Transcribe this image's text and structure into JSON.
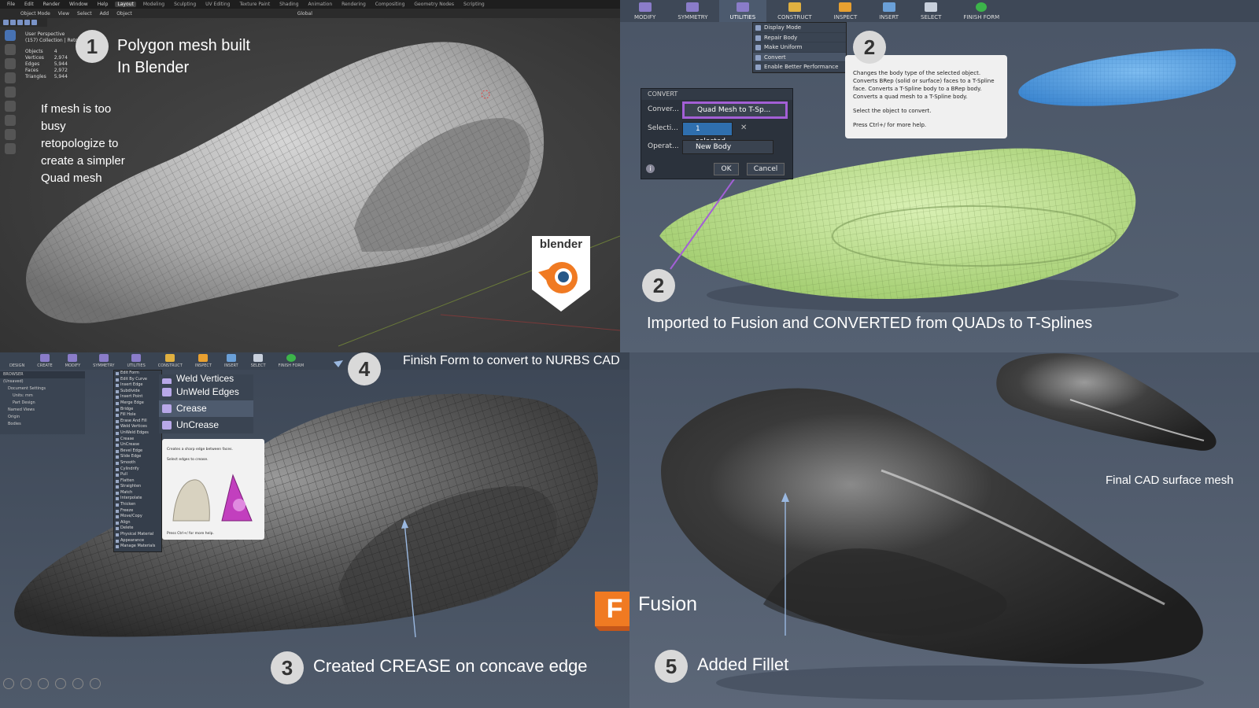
{
  "blender": {
    "menubar": [
      "File",
      "Edit",
      "Render",
      "Window",
      "Help"
    ],
    "workspaces": [
      "Layout",
      "Modeling",
      "Sculpting",
      "UV Editing",
      "Texture Paint",
      "Shading",
      "Animation",
      "Rendering",
      "Compositing",
      "Geometry Nodes",
      "Scripting"
    ],
    "header_items": [
      "Object Mode",
      "View",
      "Select",
      "Add",
      "Object"
    ],
    "orientation": "Global",
    "viewport_title": "User Perspective",
    "collection": "(157) Collection | Retopo",
    "stats": [
      {
        "label": "Objects",
        "value": "4"
      },
      {
        "label": "Vertices",
        "value": "2,974"
      },
      {
        "label": "Edges",
        "value": "5,944"
      },
      {
        "label": "Faces",
        "value": "2,972"
      },
      {
        "label": "Triangles",
        "value": "5,944"
      }
    ],
    "step_number": "1",
    "caption_line1": "Polygon mesh built",
    "caption_line2": "In Blender",
    "note_lines": [
      "If mesh is too",
      "busy",
      "retopologize to",
      "create a simpler",
      "Quad mesh"
    ],
    "logo_text": "blender"
  },
  "fusion_convert": {
    "toolbar": [
      "MODIFY",
      "SYMMETRY",
      "UTILITIES",
      "CONSTRUCT",
      "INSPECT",
      "INSERT",
      "SELECT",
      "FINISH FORM"
    ],
    "utilities_menu": [
      "Display Mode",
      "Repair Body",
      "Make Uniform",
      "Convert",
      "Enable Better Performance"
    ],
    "tooltip_lines": [
      "Changes the body type of the selected object. Converts BRep (solid or surface) faces to a T-Spline face. Converts a T-Spline body to a BRep body. Converts a quad mesh to a T-Spline body.",
      "Select the object to convert.",
      "Press Ctrl+/ for more help."
    ],
    "tooltip_step": "2",
    "dialog": {
      "title": "CONVERT",
      "convert_label": "Conver...",
      "convert_value": "Quad Mesh to T-Sp...",
      "selection_label": "Selecti...",
      "selection_value": "1 selected",
      "operation_label": "Operat...",
      "operation_value": "New Body",
      "ok": "OK",
      "cancel": "Cancel"
    },
    "step_number": "2",
    "caption": "Imported to Fusion and CONVERTED from QUADs to T-Splines"
  },
  "fusion_crease": {
    "toolbar": [
      "DESIGN",
      "CREATE",
      "MODIFY",
      "SYMMETRY",
      "UTILITIES",
      "CONSTRUCT",
      "INSPECT",
      "INSERT",
      "SELECT",
      "FINISH FORM"
    ],
    "browser_label": "BROWSER",
    "browser_items": [
      "(Unsaved)",
      "Document Settings",
      "Units: mm",
      "Part Design",
      "Named Views",
      "Origin",
      "Bodies"
    ],
    "modify_menu": [
      "Edit Form",
      "Edit By Curve",
      "Insert Edge",
      "Subdivide",
      "Insert Point",
      "Merge Edge",
      "Bridge",
      "Fill Hole",
      "Erase And Fill",
      "Weld Vertices",
      "UnWeld Edges",
      "Crease",
      "UnCrease",
      "Bevel Edge",
      "Slide Edge",
      "Smooth",
      "Cylindrify",
      "Pull",
      "Flatten",
      "Straighten",
      "Match",
      "Interpolate",
      "Thicken",
      "Freeze",
      "Move/Copy",
      "Align",
      "Delete",
      "Physical Material",
      "Appearance",
      "Manage Materials"
    ],
    "big_menu": [
      "Weld Vertices",
      "UnWeld Edges",
      "Crease",
      "UnCrease"
    ],
    "tooltip_lines": [
      "Creates a sharp edge between faces.",
      "Select edges to crease.",
      "Press Ctrl+/ for more help."
    ],
    "finish_step": "4",
    "finish_caption": "Finish Form to convert to NURBS CAD",
    "step_number": "3",
    "caption": "Created CREASE on concave edge",
    "fusion_logo_letter": "F",
    "fusion_logo_text": "Fusion"
  },
  "fusion_final": {
    "step_number": "5",
    "caption": "Added Fillet",
    "final_caption": "Final CAD surface mesh"
  },
  "colors": {
    "accent": "#a35fd6",
    "mesh_green": "#b8e08a",
    "mesh_blue": "#4f9be0",
    "fusion_orange": "#f07a22"
  }
}
